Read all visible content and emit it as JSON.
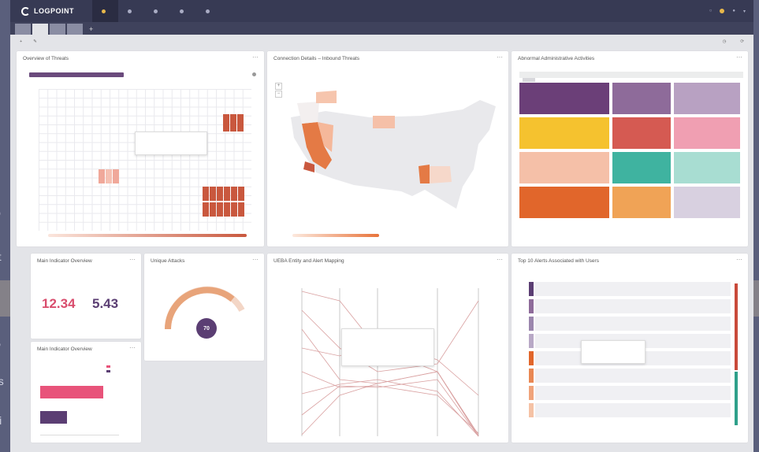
{
  "app": {
    "brand": "LOGPOINT",
    "nav": [
      "",
      "",
      "",
      "",
      ""
    ],
    "tabs": [
      "",
      "",
      "",
      ""
    ],
    "colors": {
      "nav_bg": "#373a54",
      "accent": "#e8b84a",
      "page_bg": "#e3e4e8",
      "outer_bg": "#5a5f7c"
    }
  },
  "panels": {
    "threats": {
      "title": "Overview of Threats"
    },
    "geo": {
      "title": "Connection Details – Inbound Threats"
    },
    "admin": {
      "title": "Abnormal Administrative Activities"
    },
    "kpi1": {
      "title": "Main Indicator Overview",
      "left_value": "12.34",
      "right_value": "5.43"
    },
    "gauge": {
      "title": "Unique Attacks",
      "value": "70"
    },
    "ueba": {
      "title": "UEBA Entity and Alert Mapping"
    },
    "top10": {
      "title": "Top 10 Alerts Associated with Users"
    },
    "kpi2": {
      "title": "Main Indicator Overview"
    }
  },
  "background": {
    "edge_letters": [
      "lo",
      "et",
      "n",
      "o,",
      "es",
      "Vi"
    ]
  },
  "treemap_colors": [
    [
      "#6b3f78",
      "#8e6b9a",
      "#b8a1c2"
    ],
    [
      "#f5c22f",
      "#d55a52",
      "#f09fb2"
    ],
    [
      "#f5c0a8",
      "#3fb3a0",
      "#a8ddd2"
    ],
    [
      "#e1662b",
      "#f0a356",
      "#d8d0e0"
    ]
  ],
  "kpi2_bars": [
    {
      "color": "#e8537a",
      "value": 0.8
    },
    {
      "color": "#5b3e73",
      "value": 0.34
    }
  ],
  "top10_bars": [
    {
      "color": "#5b3e73"
    },
    {
      "color": "#8e6b9a"
    },
    {
      "color": "#9b86ad"
    },
    {
      "color": "#b8a8c6"
    },
    {
      "color": "#e1662b"
    },
    {
      "color": "#e98753"
    },
    {
      "color": "#f0a37a"
    },
    {
      "color": "#f5c2a5"
    }
  ]
}
